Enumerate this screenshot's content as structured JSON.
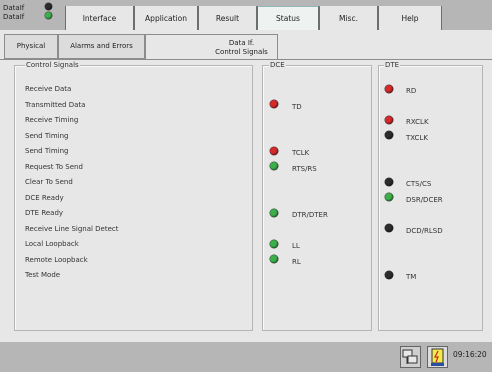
{
  "top_left": [
    {
      "label": "DataIf",
      "led": "#2c2c2c"
    },
    {
      "label": "DataIf",
      "led": "#3bb04a"
    }
  ],
  "tabs": [
    {
      "label": "Interface"
    },
    {
      "label": "Application"
    },
    {
      "label": "Result"
    },
    {
      "label": "Status"
    },
    {
      "label": "Misc."
    },
    {
      "label": "Help"
    }
  ],
  "sub_tabs": [
    {
      "label": "Physical"
    },
    {
      "label": "Alarms and Errors"
    },
    {
      "label": "Data If.\nControl Signals"
    }
  ],
  "groups": {
    "control": "Control Signals",
    "dce": "DCE",
    "dte": "DTE"
  },
  "rows": [
    {
      "label": "Receive Data",
      "dce": null,
      "dte": {
        "name": "RD",
        "color": "#d42a2a"
      }
    },
    {
      "label": "Transmitted Data",
      "dce": {
        "name": "TD",
        "color": "#d42a2a"
      },
      "dte": null
    },
    {
      "label": "Receive Timing",
      "dce": null,
      "dte": {
        "name": "RXCLK",
        "color": "#d42a2a"
      }
    },
    {
      "label": "Send Timing",
      "dce": null,
      "dte": {
        "name": "TXCLK",
        "color": "#2c2c2c"
      }
    },
    {
      "label": "Send Timing",
      "dce": {
        "name": "TCLK",
        "color": "#d42a2a"
      },
      "dte": null
    },
    {
      "label": "Request To Send",
      "dce": {
        "name": "RTS/RS",
        "color": "#3bb04a"
      },
      "dte": null
    },
    {
      "label": "Clear To Send",
      "dce": null,
      "dte": {
        "name": "CTS/CS",
        "color": "#2c2c2c"
      }
    },
    {
      "label": "DCE Ready",
      "dce": null,
      "dte": {
        "name": "DSR/DCER",
        "color": "#3bb04a"
      }
    },
    {
      "label": "DTE Ready",
      "dce": {
        "name": "DTR/DTER",
        "color": "#3bb04a"
      },
      "dte": null
    },
    {
      "label": "Receive Line Signal Detect",
      "dce": null,
      "dte": {
        "name": "DCD/RLSD",
        "color": "#2c2c2c"
      }
    },
    {
      "label": "Local Loopback",
      "dce": {
        "name": "LL",
        "color": "#3bb04a"
      },
      "dte": null
    },
    {
      "label": "Remote Loopback",
      "dce": {
        "name": "RL",
        "color": "#3bb04a"
      },
      "dte": null
    },
    {
      "label": "Test Mode",
      "dce": null,
      "dte": {
        "name": "TM",
        "color": "#2c2c2c"
      }
    }
  ],
  "status_bar": {
    "clock": "09:16:20",
    "icons": [
      "network-icon",
      "power-icon"
    ]
  }
}
